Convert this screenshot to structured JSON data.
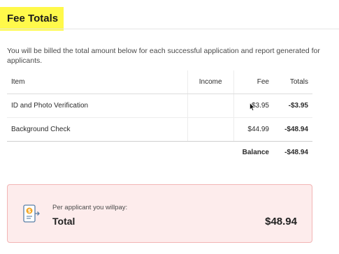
{
  "section": {
    "title": "Fee Totals",
    "description": "You will be billed the total amount below for each successful application and report generated for applicants."
  },
  "table": {
    "headers": {
      "item": "Item",
      "income": "Income",
      "fee": "Fee",
      "totals": "Totals"
    },
    "rows": [
      {
        "item": "ID and Photo Verification",
        "income": "",
        "fee": "$3.95",
        "total": "-$3.95"
      },
      {
        "item": "Background Check",
        "income": "",
        "fee": "$44.99",
        "total": "-$48.94"
      }
    ],
    "balance": {
      "label": "Balance",
      "value": "-$48.94"
    }
  },
  "summary": {
    "subtitle": "Per applicant you willpay:",
    "label": "Total",
    "amount": "$48.94",
    "icon": "dollar-document-arrow-icon",
    "accent_color": "#f5a623",
    "border_color": "#f2b4b4",
    "background_color": "#fdecec"
  },
  "highlight_color": "#fff94a"
}
